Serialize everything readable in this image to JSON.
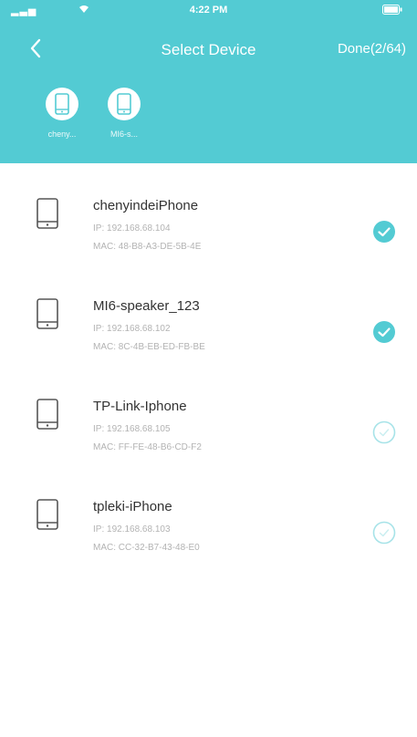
{
  "status_bar": {
    "carrier": "",
    "time": "4:22 PM",
    "battery": ""
  },
  "nav": {
    "title": "Select Device",
    "done_label": "Done(2/64)"
  },
  "selected": [
    {
      "label": "cheny..."
    },
    {
      "label": "MI6-s..."
    }
  ],
  "devices": [
    {
      "name": "chenyindeiPhone",
      "ip": "IP: 192.168.68.104",
      "mac": "MAC: 48-B8-A3-DE-5B-4E",
      "checked": true
    },
    {
      "name": "MI6-speaker_123",
      "ip": "IP: 192.168.68.102",
      "mac": "MAC: 8C-4B-EB-ED-FB-BE",
      "checked": true
    },
    {
      "name": "TP-Link-Iphone",
      "ip": "IP: 192.168.68.105",
      "mac": "MAC: FF-FE-48-B6-CD-F2",
      "checked": false
    },
    {
      "name": "tpleki-iPhone",
      "ip": "IP: 192.168.68.103",
      "mac": "MAC: CC-32-B7-43-48-E0",
      "checked": false
    }
  ],
  "colors": {
    "accent": "#53cbd3"
  }
}
